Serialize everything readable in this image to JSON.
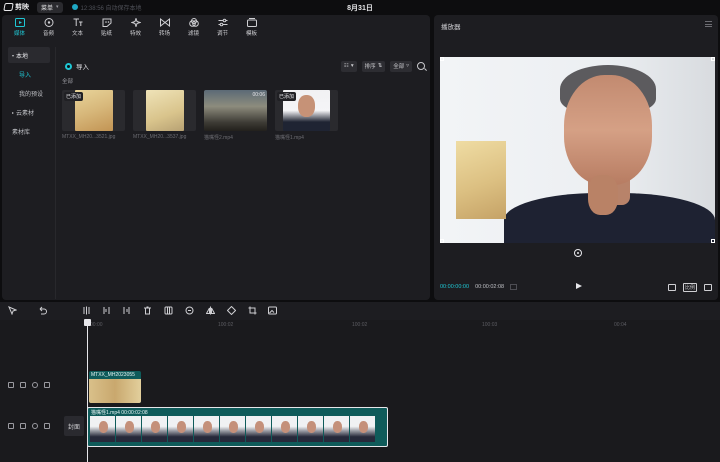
{
  "app": {
    "title": "剪映",
    "menu_label": "菜单",
    "save_status": "12:38:56 自动保存本地",
    "project_title": "8月31日"
  },
  "toolbar": {
    "tabs": [
      {
        "label": "媒体",
        "icon": "media-icon",
        "active": true
      },
      {
        "label": "音频",
        "icon": "audio-icon",
        "active": false
      },
      {
        "label": "文本",
        "icon": "text-icon",
        "active": false
      },
      {
        "label": "贴纸",
        "icon": "sticker-icon",
        "active": false
      },
      {
        "label": "特效",
        "icon": "effects-icon",
        "active": false
      },
      {
        "label": "转场",
        "icon": "transition-icon",
        "active": false
      },
      {
        "label": "滤镜",
        "icon": "filter-icon",
        "active": false
      },
      {
        "label": "调节",
        "icon": "adjust-icon",
        "active": false
      },
      {
        "label": "模板",
        "icon": "template-icon",
        "active": false
      }
    ]
  },
  "sidebar": {
    "items": [
      {
        "label": "本地",
        "type": "group-active"
      },
      {
        "label": "导入",
        "type": "sub-selected"
      },
      {
        "label": "我的预设",
        "type": "sub"
      },
      {
        "label": "云素材",
        "type": "group"
      },
      {
        "label": "素材库",
        "type": "group"
      }
    ]
  },
  "media": {
    "import_label": "导入",
    "view_chip": "☷",
    "sort_label": "排序",
    "filter_label": "全部",
    "section_label": "全部",
    "items": [
      {
        "name": "MTXX_MH20...3521.jpg",
        "badge": "已添加",
        "duration": "",
        "kind": "cat-a"
      },
      {
        "name": "MTXX_MH20...3537.jpg",
        "badge": "",
        "duration": "",
        "kind": "cat-b"
      },
      {
        "name": "猫嘴怪2.mp4",
        "badge": "",
        "duration": "00:06",
        "kind": "scene"
      },
      {
        "name": "猫嘴怪1.mp4",
        "badge": "已添加",
        "duration": "",
        "kind": "man"
      }
    ]
  },
  "player": {
    "title": "播放器",
    "current_time": "00:00:00:00",
    "total_time": "00:00:02:08",
    "ratio_label": "比例"
  },
  "timeline": {
    "ruler_labels": [
      "00:00",
      "100:02",
      "100:02",
      "100:03",
      "00:04"
    ],
    "overlay_clip": {
      "label": "MTXX_MH2023055"
    },
    "main_clip": {
      "label": "猫嘴怪1.mp4  00:00:02:08"
    },
    "cover_label": "封面",
    "frame_count": 11
  }
}
